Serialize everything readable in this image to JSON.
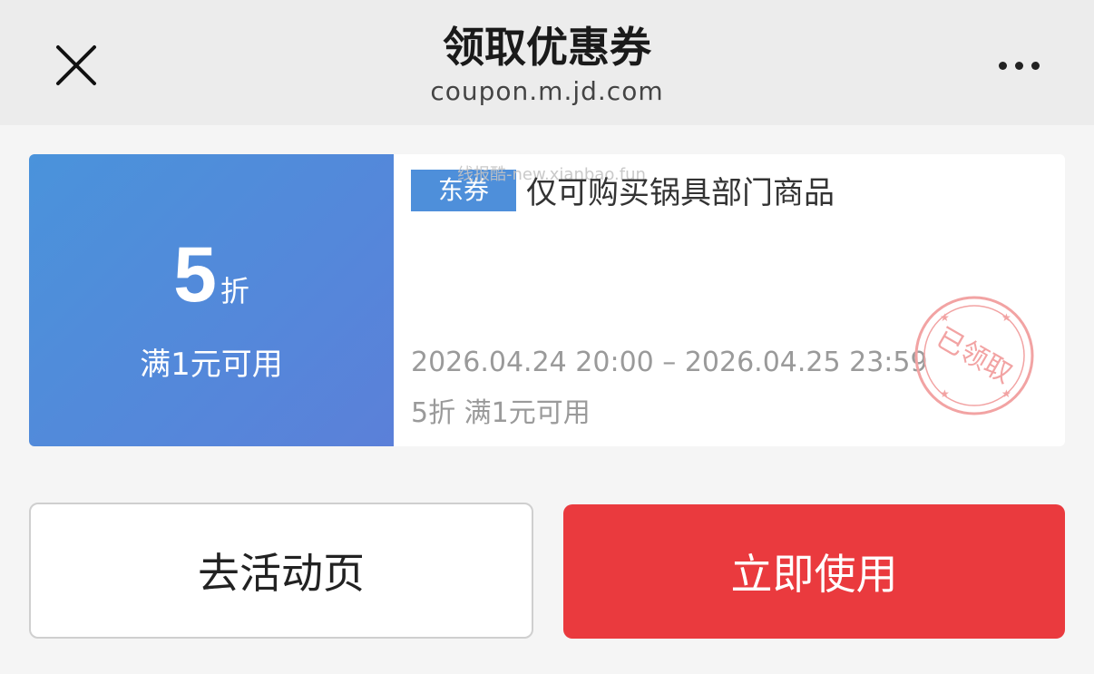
{
  "header": {
    "title": "领取优惠券",
    "domain": "coupon.m.jd.com",
    "close_icon": "close-icon",
    "more_icon": "more-icon"
  },
  "coupon": {
    "discount_value": "5",
    "discount_unit": "折",
    "threshold": "满1元可用",
    "tag": "东券",
    "watermark": "线报酷-new.xianbao.fun",
    "scope": "仅可购买锅具部门商品",
    "validity": "2026.04.24 20:00 – 2026.04.25 23:59",
    "summary": "5折 满1元可用",
    "stamp_text": "已领取",
    "left_color": "#4a93db",
    "stamp_color": "#f2a3a3"
  },
  "actions": {
    "activity_label": "去活动页",
    "use_label": "立即使用",
    "use_color": "#ea3a3e"
  }
}
